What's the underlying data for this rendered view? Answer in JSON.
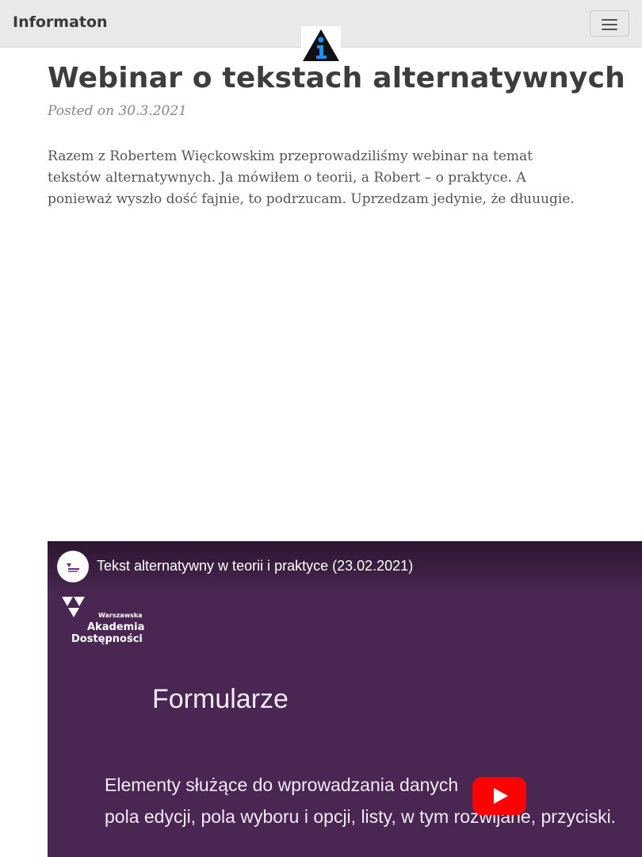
{
  "navbar": {
    "brand": "Informaton",
    "menu_icon": "hamburger-menu-icon",
    "logo_icon": "information-triangle-logo-icon"
  },
  "post": {
    "title": "Webinar o tekstach alternatywnych",
    "posted_label": "Posted on 30.3.2021",
    "intro": "Razem z Robertem Więckowskim przeprowadziliśmy webinar na temat tekstów alternatywnych. Ja mówiłem o teorii, a Robert – o praktyce. A ponieważ wyszło dość fajnie, to podrzucam. Uprzedzam jedynie, że dłuuugie."
  },
  "video": {
    "title": "Tekst alternatywny w teorii i praktyce (23.02.2021)",
    "org_small": "Warszawska",
    "org_line1": "Akademia",
    "org_line2": "Dostępności",
    "slide_heading": "Formularze",
    "slide_line1": "Elementy służące do wprowadzania danych",
    "slide_line2": "pola edycji, pola wyboru i opcji, listy, w tym rozwijane, przyciski.",
    "play_icon": "youtube-play-icon",
    "background_color": "#4a2752"
  }
}
